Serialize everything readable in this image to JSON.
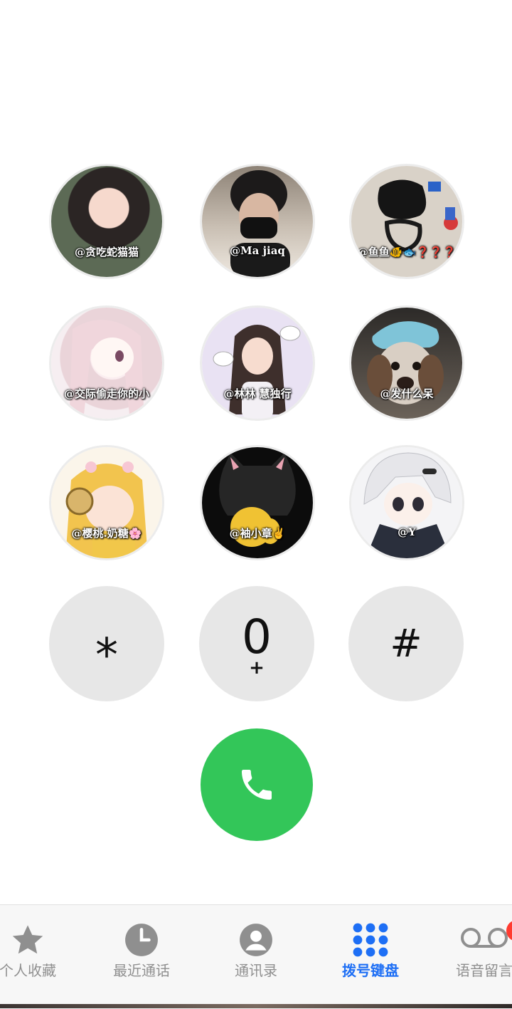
{
  "contacts": [
    {
      "label": "@贪吃蛇猫猫"
    },
    {
      "label": "@Ma jiaq"
    },
    {
      "label": "@鱼鱼🐠🐟❓❓❓"
    },
    {
      "label": "@交际偷走你的小"
    },
    {
      "label": "@林林 慧独行"
    },
    {
      "label": "@发什么呆"
    },
    {
      "label": "@樱桃.奶糖🌸"
    },
    {
      "label": "@袖小章✌"
    },
    {
      "label": "@Y"
    }
  ],
  "keypad": {
    "star": "*",
    "zero": "0",
    "zero_sub": "+",
    "hash": "#"
  },
  "tabs": [
    {
      "label": "个人收藏",
      "icon": "star-icon"
    },
    {
      "label": "最近通话",
      "icon": "clock-icon"
    },
    {
      "label": "通讯录",
      "icon": "contact-icon"
    },
    {
      "label": "拨号键盘",
      "icon": "keypad-icon"
    },
    {
      "label": "语音留言",
      "icon": "voicemail-icon"
    }
  ],
  "active_tab": "拨号键盘",
  "colors": {
    "accent": "#1e6ff5",
    "call_button": "#33c659",
    "key_bg": "#e7e7e7",
    "badge": "#ff3b30",
    "tab_inactive": "#8f8f8f"
  }
}
